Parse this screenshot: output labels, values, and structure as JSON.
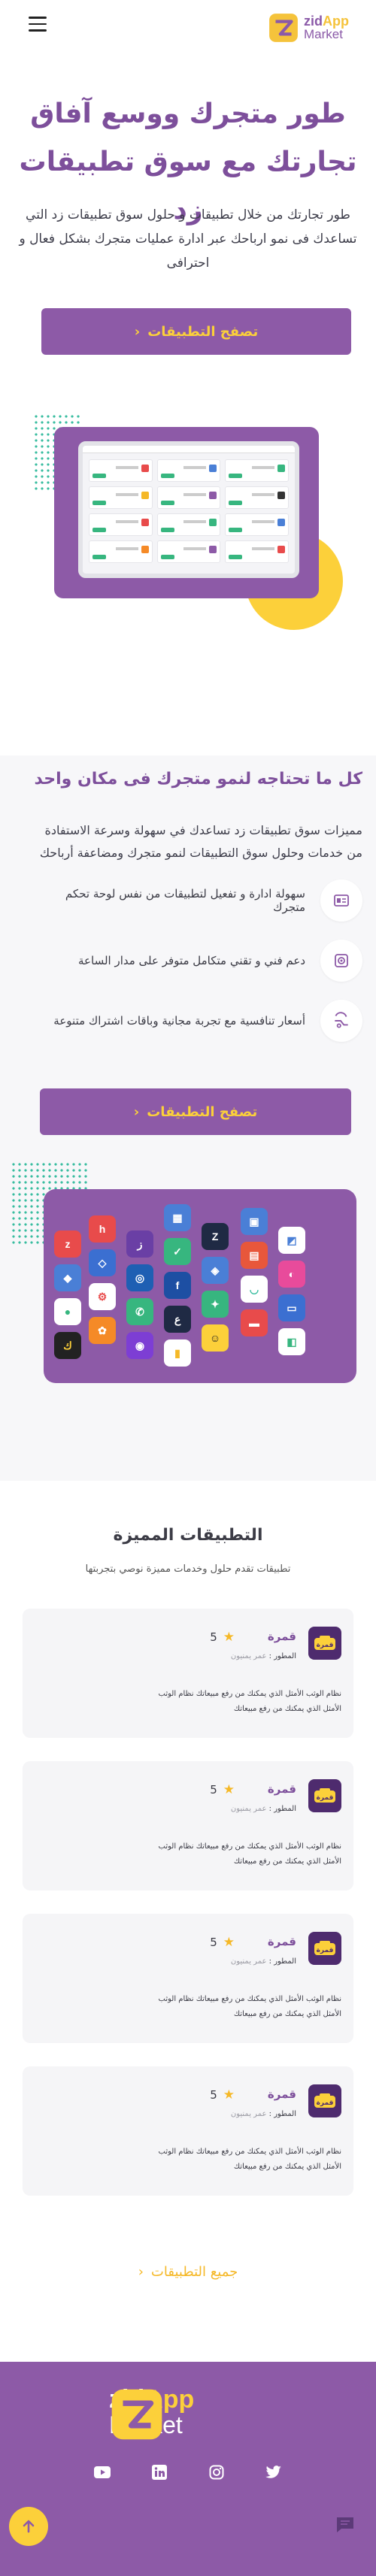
{
  "header": {
    "logo_line1": "zid",
    "logo_line1b": "App",
    "logo_line2": "Market"
  },
  "hero": {
    "title_line1": "طور متجرك ووسع آفاق",
    "title_line2": "تجارتك مع سوق تطبيقات زد",
    "description": "طور تجارتك من خلال تطبيقات و حلول سوق تطبيقات زد التي تساعدك فى نمو ارباحك عبر ادارة عمليات متجرك بشكل فعال و احترافى",
    "cta_label": "تصفح التطبيقات"
  },
  "features": {
    "title": "كل ما تحتاجه لنمو متجرك فى مكان واحد",
    "description": "مميزات سوق تطبيقات زد تساعدك في سهولة وسرعة الاستفادة من خدمات وحلول سوق التطبيقات لنمو متجرك ومضاعفة أرباحك",
    "items": [
      {
        "text": "سهولة ادارة و تفعيل لتطبيقات من نفس لوحة تحكم متجرك",
        "icon": "dashboard-icon"
      },
      {
        "text": "دعم فني و تقني متكامل متوفر على مدار الساعة",
        "icon": "support-icon"
      },
      {
        "text": "أسعار تنافسية مع تجربة مجانية وباقات اشتراك متنوعة",
        "icon": "pricing-icon"
      }
    ],
    "cta_label": "تصفح التطبيقات"
  },
  "featured": {
    "title": "التطبيقات المميزة",
    "subtitle": "تطبيقات تقدم حلول وخدمات مميزة نوصي بتجربتها",
    "apps": [
      {
        "name": "قمرة",
        "rating": "5",
        "developer_label": "المطور :",
        "developer": "عمر يمنيون",
        "description": "نظام الوثب الأمثل الذي يمكنك من رفع مبيعاتك نظام الوثب الأمثل الذي يمكنك من رفع مبيعاتك"
      },
      {
        "name": "قمرة",
        "rating": "5",
        "developer_label": "المطور :",
        "developer": "عمر يمنيون",
        "description": "نظام الوثب الأمثل الذي يمكنك من رفع مبيعاتك نظام الوثب الأمثل الذي يمكنك من رفع مبيعاتك"
      },
      {
        "name": "قمرة",
        "rating": "5",
        "developer_label": "المطور :",
        "developer": "عمر يمنيون",
        "description": "نظام الوثب الأمثل الذي يمكنك من رفع مبيعاتك نظام الوثب الأمثل الذي يمكنك من رفع مبيعاتك"
      },
      {
        "name": "قمرة",
        "rating": "5",
        "developer_label": "المطور :",
        "developer": "عمر يمنيون",
        "description": "نظام الوثب الأمثل الذي يمكنك من رفع مبيعاتك نظام الوثب الأمثل الذي يمكنك من رفع مبيعاتك"
      }
    ],
    "all_apps_label": "جميع التطبيقات"
  },
  "footer": {
    "logo_line1": "zid",
    "logo_line1b": "App",
    "logo_line2": "Market",
    "socials": [
      "youtube-icon",
      "linkedin-icon",
      "instagram-icon",
      "twitter-icon"
    ]
  },
  "colors": {
    "brand_purple": "#8d5aa7",
    "title_purple": "#7d4f9b",
    "accent_yellow": "#fcd03a",
    "dots_green": "#39bda0"
  }
}
